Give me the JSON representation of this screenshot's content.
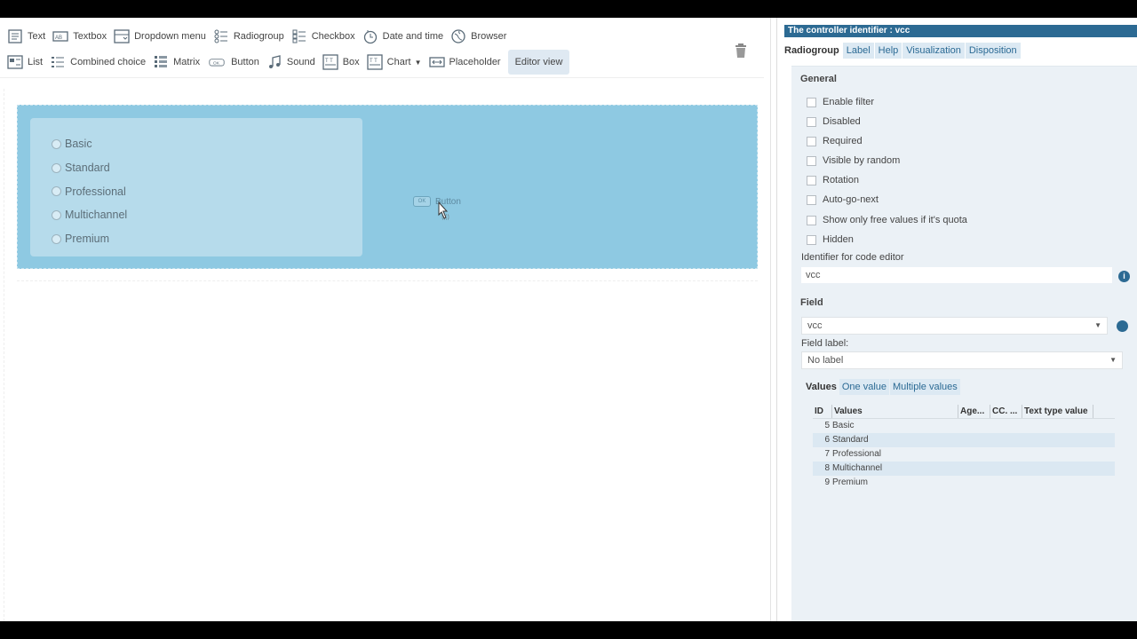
{
  "toolbar": {
    "row1": [
      {
        "label": "Text",
        "icon": "text-icon"
      },
      {
        "label": "Textbox",
        "icon": "textbox-icon"
      },
      {
        "label": "Dropdown menu",
        "icon": "dropdown-icon"
      },
      {
        "label": "Radiogroup",
        "icon": "radiogroup-icon"
      },
      {
        "label": "Checkbox",
        "icon": "checkbox-list-icon"
      },
      {
        "label": "Date and time",
        "icon": "clock-icon"
      },
      {
        "label": "Browser",
        "icon": "globe-icon"
      }
    ],
    "row2": [
      {
        "label": "List",
        "icon": "list-icon"
      },
      {
        "label": "Combined choice",
        "icon": "combined-choice-icon"
      },
      {
        "label": "Matrix",
        "icon": "matrix-icon"
      },
      {
        "label": "Button",
        "icon": "button-icon"
      },
      {
        "label": "Sound",
        "icon": "music-note-icon"
      },
      {
        "label": "Box",
        "icon": "box-icon"
      },
      {
        "label": "Chart",
        "icon": "chart-icon"
      },
      {
        "label": "Placeholder",
        "icon": "placeholder-icon"
      }
    ],
    "editor_view_label": "Editor view"
  },
  "canvas": {
    "radio_options": [
      "Basic",
      "Standard",
      "Professional",
      "Multichannel",
      "Premium"
    ],
    "ghost_label": "Button",
    "ghost_icon_text": "OK"
  },
  "props": {
    "title": "The controller identifier : vcc",
    "tabs": [
      "Radiogroup",
      "Label",
      "Help",
      "Visualization",
      "Disposition"
    ],
    "general": {
      "title": "General",
      "checkboxes": [
        "Enable filter",
        "Disabled",
        "Required",
        "Visible by random",
        "Rotation",
        "Auto-go-next",
        "Show only free values if it's quota",
        "Hidden"
      ],
      "identifier_label": "Identifier for code editor",
      "identifier_value": "vcc"
    },
    "field": {
      "title": "Field",
      "field_value": "vcc",
      "field_label_caption": "Field label:",
      "field_label_value": "No label"
    },
    "values": {
      "tabs": [
        "Values",
        "One value",
        "Multiple values"
      ],
      "columns": [
        "ID",
        "Values",
        "Age...",
        "CC. ...",
        "Text type value"
      ],
      "rows": [
        {
          "id": "5",
          "value": "Basic"
        },
        {
          "id": "6",
          "value": "Standard"
        },
        {
          "id": "7",
          "value": "Professional"
        },
        {
          "id": "8",
          "value": "Multichannel"
        },
        {
          "id": "9",
          "value": "Premium"
        }
      ]
    }
  },
  "colors": {
    "accent": "#2c6a93",
    "drop_zone": "#8ec9e2",
    "radio_panel": "#b6dbeb",
    "panel_bg": "#ebf1f6"
  }
}
